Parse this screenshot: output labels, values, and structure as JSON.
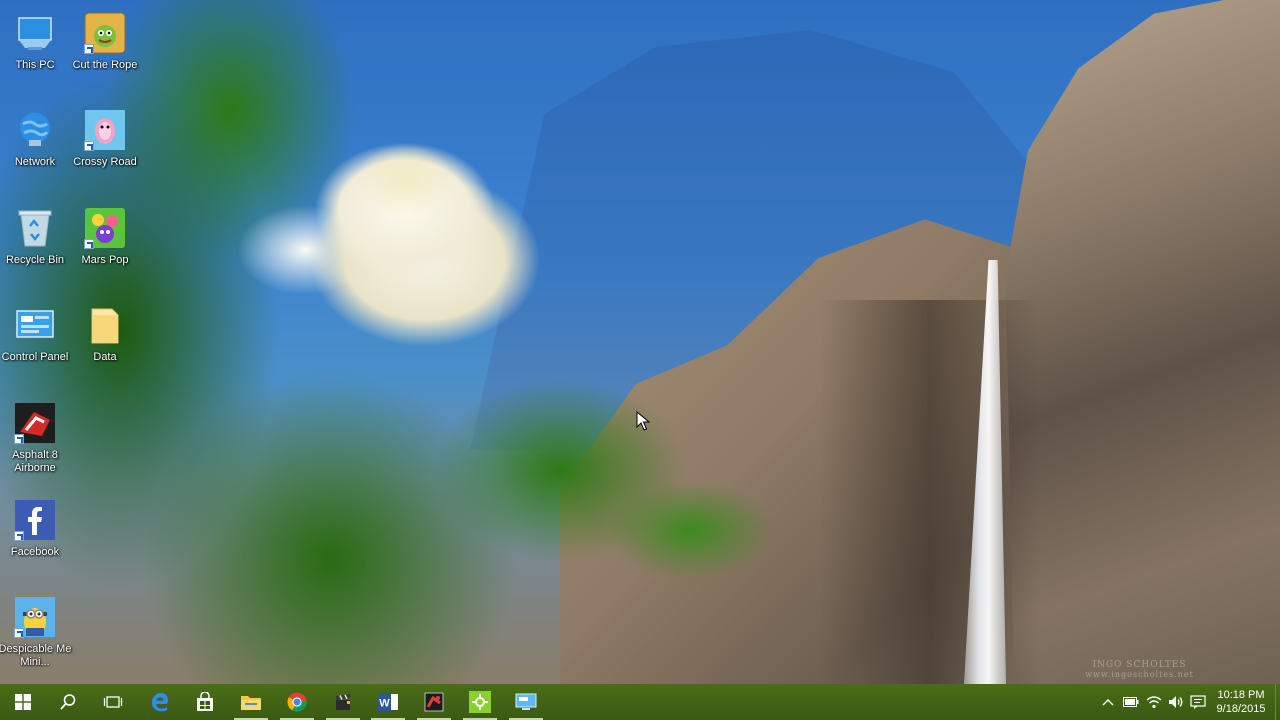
{
  "desktop": {
    "icons": [
      {
        "label": "This PC",
        "icon": "this-pc-icon",
        "shortcut": false
      },
      {
        "label": "Cut the Rope",
        "icon": "cut-the-rope-icon",
        "shortcut": true
      },
      {
        "label": "Network",
        "icon": "network-icon",
        "shortcut": false
      },
      {
        "label": "Crossy Road",
        "icon": "crossy-road-icon",
        "shortcut": true
      },
      {
        "label": "Recycle Bin",
        "icon": "recycle-bin-icon",
        "shortcut": false
      },
      {
        "label": "Mars Pop",
        "icon": "mars-pop-icon",
        "shortcut": true
      },
      {
        "label": "Control Panel",
        "icon": "control-panel-icon",
        "shortcut": false
      },
      {
        "label": "Data",
        "icon": "folder-icon",
        "shortcut": false
      },
      {
        "label": "Asphalt 8 Airborne",
        "icon": "asphalt-8-icon",
        "shortcut": true
      },
      {
        "label": "Facebook",
        "icon": "facebook-icon",
        "shortcut": true
      },
      {
        "label": "Despicable Me Mini...",
        "icon": "despicable-me-icon",
        "shortcut": true
      }
    ],
    "wallpaper_watermark": {
      "line1": "INGO SCHOLTES",
      "line2": "www.ingoscholtes.net"
    }
  },
  "taskbar": {
    "buttons": [
      {
        "name": "start-button",
        "icon": "windows-logo-icon"
      },
      {
        "name": "search-button",
        "icon": "search-icon"
      },
      {
        "name": "task-view-button",
        "icon": "task-view-icon"
      },
      {
        "name": "edge-button",
        "icon": "edge-icon"
      },
      {
        "name": "store-button",
        "icon": "store-icon"
      },
      {
        "name": "file-explorer-button",
        "icon": "folder-icon"
      },
      {
        "name": "chrome-button",
        "icon": "chrome-icon"
      },
      {
        "name": "studio-button",
        "icon": "clapper-icon"
      },
      {
        "name": "word-button",
        "icon": "word-icon"
      },
      {
        "name": "recorder-button",
        "icon": "recorder-icon"
      },
      {
        "name": "green-app-button",
        "icon": "green-app-icon"
      },
      {
        "name": "remote-desktop-button",
        "icon": "monitor-icon"
      }
    ],
    "tray": {
      "icons": [
        "chevron-up-icon",
        "battery-icon",
        "wifi-icon",
        "volume-icon",
        "keyboard-icon"
      ],
      "time": "10:18 PM",
      "date": "9/18/2015"
    },
    "color": "#3d5e14"
  }
}
